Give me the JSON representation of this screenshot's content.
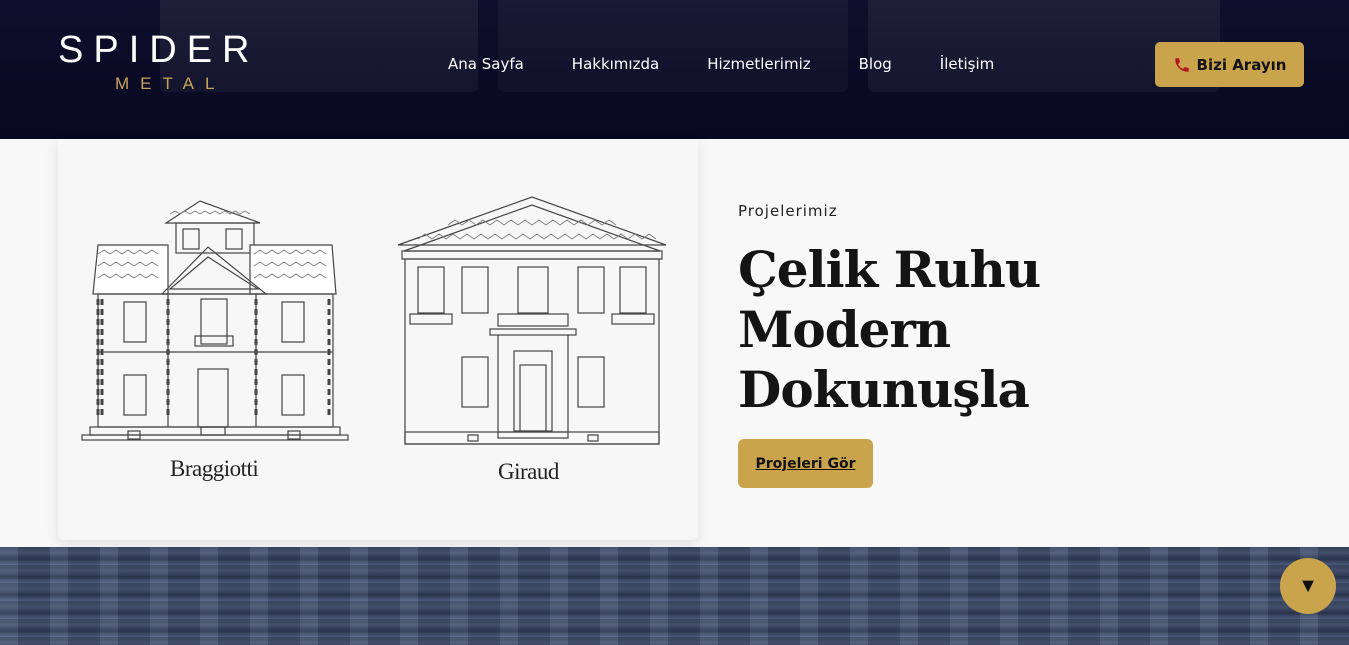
{
  "brand": {
    "name": "SPIDER",
    "tagline": "METAL",
    "accent_color": "#c9a44c",
    "header_color": "#0b0b27"
  },
  "nav": {
    "items": [
      {
        "label": "Ana Sayfa"
      },
      {
        "label": "Hakkımızda"
      },
      {
        "label": "Hizmetlerimiz"
      },
      {
        "label": "Blog"
      },
      {
        "label": "İletişim"
      }
    ]
  },
  "header": {
    "call_button_label": "Bizi Arayın",
    "call_icon": "phone-icon"
  },
  "hero": {
    "illustration": {
      "buildings": [
        {
          "label": "Braggiotti"
        },
        {
          "label": "Giraud"
        }
      ]
    },
    "eyebrow": "Projelerimiz",
    "headline_lines": [
      "Çelik Ruhu",
      "Modern",
      "Dokunuşla"
    ],
    "cta_label": "Projeleri Gör"
  },
  "scroll_button": {
    "icon": "chevron-down-icon",
    "glyph": "▼"
  }
}
